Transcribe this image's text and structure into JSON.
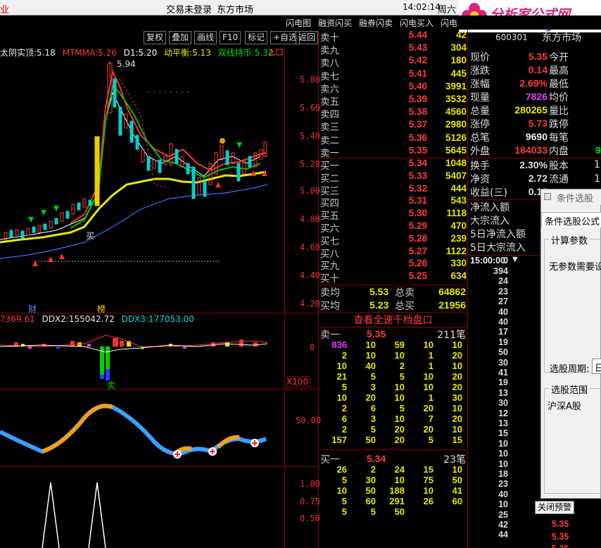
{
  "menubar": {
    "left_fragment": "业",
    "login": "交易未登录",
    "market": "东方市场",
    "time": "14:02:14",
    "weekday": "周六"
  },
  "logo": {
    "title": "分析家公式网",
    "url": "www.88gs.com"
  },
  "topbar": {
    "items": [
      "闪电图",
      "融资闪买",
      "融券闪卖",
      "闪电买入",
      "闪电"
    ]
  },
  "stock_header": {
    "code": "600301",
    "market": "东方市场"
  },
  "toolbar": {
    "buttons": [
      "复权",
      "叠加",
      "画线",
      "F10",
      "标记",
      "+自选",
      "返回"
    ]
  },
  "indicator_line": {
    "a_label": "太阴实顶:",
    "a_value": "5.18",
    "b_label": "MTMMA:",
    "b_value": "5.26",
    "c_label": "D1:",
    "c_value": "5.20",
    "d_label": "动平衡:",
    "d_value": "5.13",
    "e_label": "双线持币:",
    "e_value": "5.32"
  },
  "price_axis": [
    "5.80",
    "5.60",
    "5.40",
    "5.20",
    "5.00",
    "4.80",
    "4.60",
    "4.40",
    "4.20"
  ],
  "peak_label": "5.94",
  "buy_marker": "买",
  "sell_marker": "卖",
  "markers": {
    "cai": "财",
    "bang": "榜"
  },
  "ddx_line": {
    "a_value": "7369.61",
    "b_label": "DDX2:",
    "b_value": "155042.72",
    "c_label": "DDX3:",
    "c_value": "177053.00"
  },
  "ddx_axis": {
    "zero": "0",
    "scale": "X100"
  },
  "osc_axis": [
    "50.00"
  ],
  "bottom_axis": [
    "1.00",
    "0.75",
    "0.50"
  ],
  "sell_quotes": [
    {
      "name": "卖十",
      "price": "5.44",
      "vol": "42"
    },
    {
      "name": "卖九",
      "price": "5.43",
      "vol": "304"
    },
    {
      "name": "卖八",
      "price": "5.42",
      "vol": "180"
    },
    {
      "name": "卖七",
      "price": "5.41",
      "vol": "445"
    },
    {
      "name": "卖六",
      "price": "5.40",
      "vol": "3991"
    },
    {
      "name": "卖五",
      "price": "5.39",
      "vol": "3532"
    },
    {
      "name": "卖四",
      "price": "5.38",
      "vol": "4560"
    },
    {
      "name": "卖三",
      "price": "5.37",
      "vol": "2980"
    },
    {
      "name": "卖二",
      "price": "5.36",
      "vol": "5126"
    },
    {
      "name": "卖一",
      "price": "5.35",
      "vol": "5645"
    }
  ],
  "buy_quotes": [
    {
      "name": "买一",
      "price": "5.34",
      "vol": "1048"
    },
    {
      "name": "买二",
      "price": "5.33",
      "vol": "5407"
    },
    {
      "name": "买三",
      "price": "5.32",
      "vol": "444"
    },
    {
      "name": "买四",
      "price": "5.31",
      "vol": "543"
    },
    {
      "name": "买五",
      "price": "5.30",
      "vol": "1118"
    },
    {
      "name": "买六",
      "price": "5.29",
      "vol": "470"
    },
    {
      "name": "买七",
      "price": "5.28",
      "vol": "239"
    },
    {
      "name": "买八",
      "price": "5.27",
      "vol": "1122"
    },
    {
      "name": "买九",
      "price": "5.26",
      "vol": "330"
    },
    {
      "name": "买十",
      "price": "5.25",
      "vol": "634"
    }
  ],
  "avg": {
    "sell_avg_label": "卖均",
    "sell_avg": "5.53",
    "sell_total_label": "总卖",
    "sell_total": "64862",
    "buy_avg_label": "买均",
    "buy_avg": "5.23",
    "buy_total_label": "总买",
    "buy_total": "21956"
  },
  "thousand_link": "查看全速千档盘口",
  "order_sell": {
    "label": "卖一",
    "price": "5.35",
    "count": "211笔",
    "rows": [
      [
        "836",
        "10",
        "59",
        "10",
        "10"
      ],
      [
        "2",
        "10",
        "10",
        "1",
        "20"
      ],
      [
        "10",
        "40",
        "2",
        "1",
        "10"
      ],
      [
        "21",
        "5",
        "5",
        "10",
        "20"
      ],
      [
        "5",
        "3",
        "10",
        "10",
        "20"
      ],
      [
        "10",
        "20",
        "10",
        "1",
        "30"
      ],
      [
        "2",
        "6",
        "5",
        "20",
        "10"
      ],
      [
        "6",
        "3",
        "10",
        "7",
        "20"
      ],
      [
        "2",
        "5",
        "20",
        "20",
        "10"
      ],
      [
        "157",
        "50",
        "20",
        "5",
        "15"
      ]
    ]
  },
  "order_buy": {
    "label": "买一",
    "price": "5.34",
    "count": "23笔",
    "rows": [
      [
        "26",
        "2",
        "24",
        "15",
        "10"
      ],
      [
        "5",
        "30",
        "10",
        "75",
        "50"
      ],
      [
        "10",
        "50",
        "188",
        "10",
        "41"
      ],
      [
        "5",
        "60",
        "291",
        "26",
        "60"
      ],
      [
        "5",
        "5",
        "50",
        "",
        ""
      ]
    ]
  },
  "stats": [
    {
      "label": "现价",
      "value": "5.35",
      "color": "red",
      "label2": "今开"
    },
    {
      "label": "涨跌",
      "value": "0.14",
      "color": "red",
      "label2": "最高"
    },
    {
      "label": "涨幅",
      "value": "2.69%",
      "color": "red",
      "label2": "最低"
    },
    {
      "label": "现量",
      "value": "7826",
      "color": "magenta",
      "label2": "均价"
    },
    {
      "label": "总量",
      "value": "280265",
      "color": "yellow",
      "label2": "量比"
    },
    {
      "label": "涨停",
      "value": "5.73",
      "color": "red",
      "label2": "跌停"
    },
    {
      "label": "总笔",
      "value": "9690",
      "color": "white",
      "label2": "每笔"
    },
    {
      "label": "外盘",
      "value": "184033",
      "color": "red",
      "label2": "内盘"
    }
  ],
  "stats2": [
    {
      "label": "换手",
      "value": "2.30%",
      "label2": "股本"
    },
    {
      "label": "净资",
      "value": "2.72",
      "label2": "流通"
    },
    {
      "label": "收益(三)",
      "value": "0.12",
      "label2": ""
    }
  ],
  "flows": [
    "净流入额",
    "大宗流入",
    "5日净流入额",
    "5日大宗流入"
  ],
  "tick_header": {
    "time": "15:00:00",
    "value": "0"
  },
  "tick_values": [
    "394",
    "24",
    "23",
    "27",
    "40",
    "40",
    "17",
    "19",
    "50",
    "30",
    "41",
    "19",
    "13",
    "30",
    "12",
    "13",
    "15",
    "10",
    "10",
    "10",
    "18",
    "23",
    "40",
    "10",
    "25",
    "42",
    "44"
  ],
  "tick_prices": [
    "5.35",
    "5.35",
    "5.35"
  ],
  "right_edge_digit": "9",
  "right_edge_digits2": [
    "1",
    "1"
  ],
  "dialog": {
    "title": "条件选股",
    "tab": "条件选股公式",
    "group_params": "计算参数",
    "no_params": "无参数需要设置",
    "period_label": "选股周期:",
    "period_value": "日",
    "range_label": "选股范围",
    "range_value": "沪深A股",
    "close_alert": "关闭预警"
  }
}
